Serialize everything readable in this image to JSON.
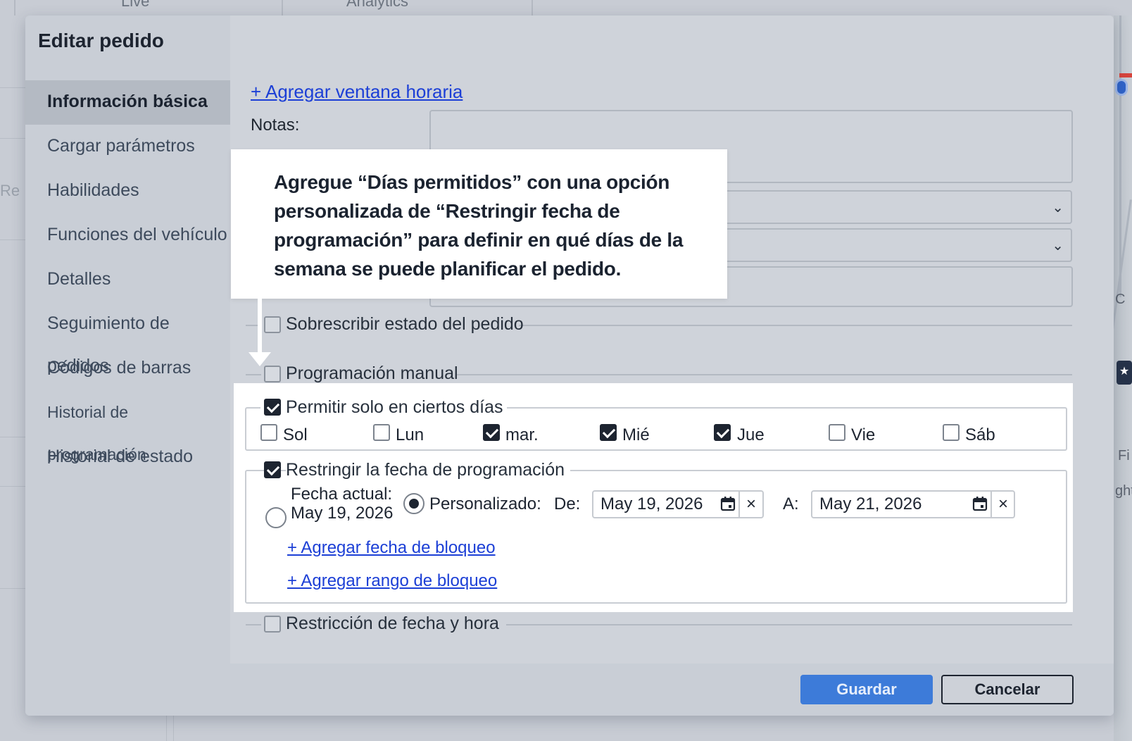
{
  "background": {
    "tabs": [
      "Live",
      "Analytics"
    ],
    "left_text": "Re",
    "right_texts": [
      "C",
      "Fi",
      "ght"
    ]
  },
  "modal": {
    "title": "Editar pedido",
    "sidebar": {
      "items": [
        {
          "label": "Información básica",
          "active": true
        },
        {
          "label": "Cargar parámetros"
        },
        {
          "label": "Habilidades"
        },
        {
          "label": "Funciones del vehículo"
        },
        {
          "label": "Detalles"
        },
        {
          "label": "Seguimiento de pedidos"
        },
        {
          "label": "Códigos de barras"
        },
        {
          "label": "Historial de programación"
        },
        {
          "label": "Historial de estado"
        }
      ]
    },
    "form": {
      "add_time_window": "+ Agregar ventana horaria",
      "notes_label": "Notas:",
      "override_status": {
        "label": "Sobrescribir estado del pedido",
        "checked": false
      },
      "manual_scheduling": {
        "label": "Programación manual",
        "checked": false
      },
      "allow_certain_days": {
        "label": "Permitir solo en ciertos días",
        "checked": true,
        "days": [
          {
            "label": "Sol",
            "checked": false
          },
          {
            "label": "Lun",
            "checked": false
          },
          {
            "label": "mar.",
            "checked": true
          },
          {
            "label": "Mié",
            "checked": true
          },
          {
            "label": "Jue",
            "checked": true
          },
          {
            "label": "Vie",
            "checked": false
          },
          {
            "label": "Sáb",
            "checked": false
          }
        ]
      },
      "restrict_date": {
        "label": "Restringir la fecha de programación",
        "checked": true,
        "current_date_label": "Fecha actual:",
        "current_date_value": "May 19, 2026",
        "custom_label": "Personalizado:",
        "from_label": "De:",
        "from_value": "May 19, 2026",
        "to_label": "A:",
        "to_value": "May 21, 2026",
        "clear_glyph": "×",
        "selected": "custom",
        "add_block_date": "+ Agregar fecha de bloqueo",
        "add_block_range": "+ Agregar rango de bloqueo"
      },
      "datetime_restriction": {
        "label": "Restricción de fecha y hora",
        "checked": false
      },
      "chevron_glyph": "⌄"
    },
    "footer": {
      "save_label": "Guardar",
      "cancel_label": "Cancelar"
    }
  },
  "callout": {
    "text": "Agregue “Días permitidos” con una opción personalizada de “Restringir fecha de programación” para definir en qué días de la semana se puede planificar el pedido."
  },
  "colors": {
    "primary_button": "#3d7bd9",
    "link": "#1c3fd6",
    "highlight": "#ffffff",
    "modal_bg": "#c9ced6"
  }
}
